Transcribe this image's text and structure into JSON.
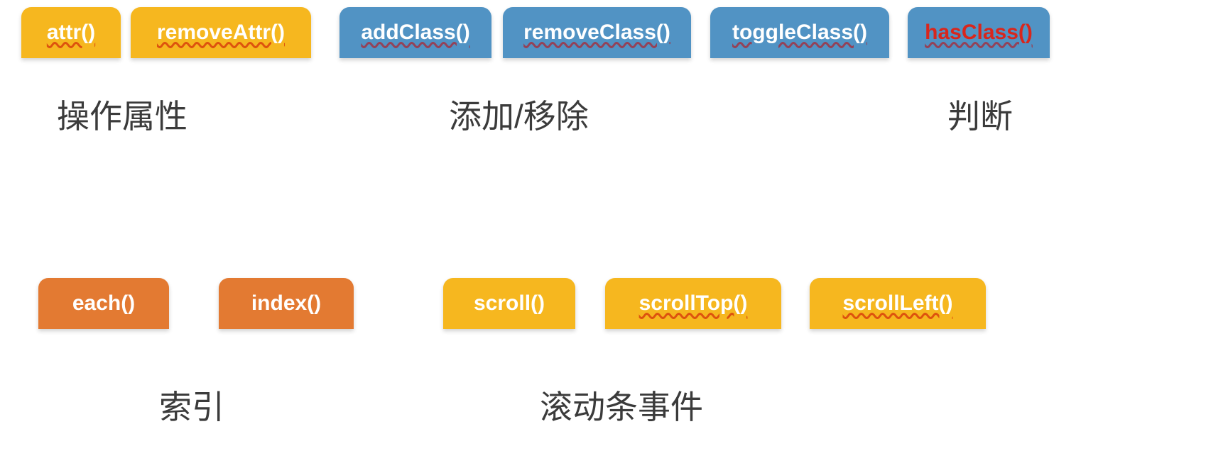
{
  "row1": {
    "attr": {
      "label": "attr()"
    },
    "removeAttr": {
      "label": "removeAttr()"
    },
    "addClass": {
      "label": "addClass()"
    },
    "removeClass": {
      "label": "removeClass()"
    },
    "toggleClass": {
      "label": "toggleClass()"
    },
    "hasClass": {
      "label": "hasClass()"
    }
  },
  "captions_row1": {
    "attrs": "操作属性",
    "addrem_pre": "添加",
    "addrem_slash": "/",
    "addrem_post": "移除",
    "judge": "判断"
  },
  "row2": {
    "each": {
      "label": "each()"
    },
    "index": {
      "label": "index()"
    },
    "scroll": {
      "label": "scroll()"
    },
    "scrollTop": {
      "label": "scrollTop()"
    },
    "scrollLeft": {
      "label": "scrollLeft()"
    }
  },
  "captions_row2": {
    "index": "索引",
    "scroll": "滚动条事件"
  }
}
